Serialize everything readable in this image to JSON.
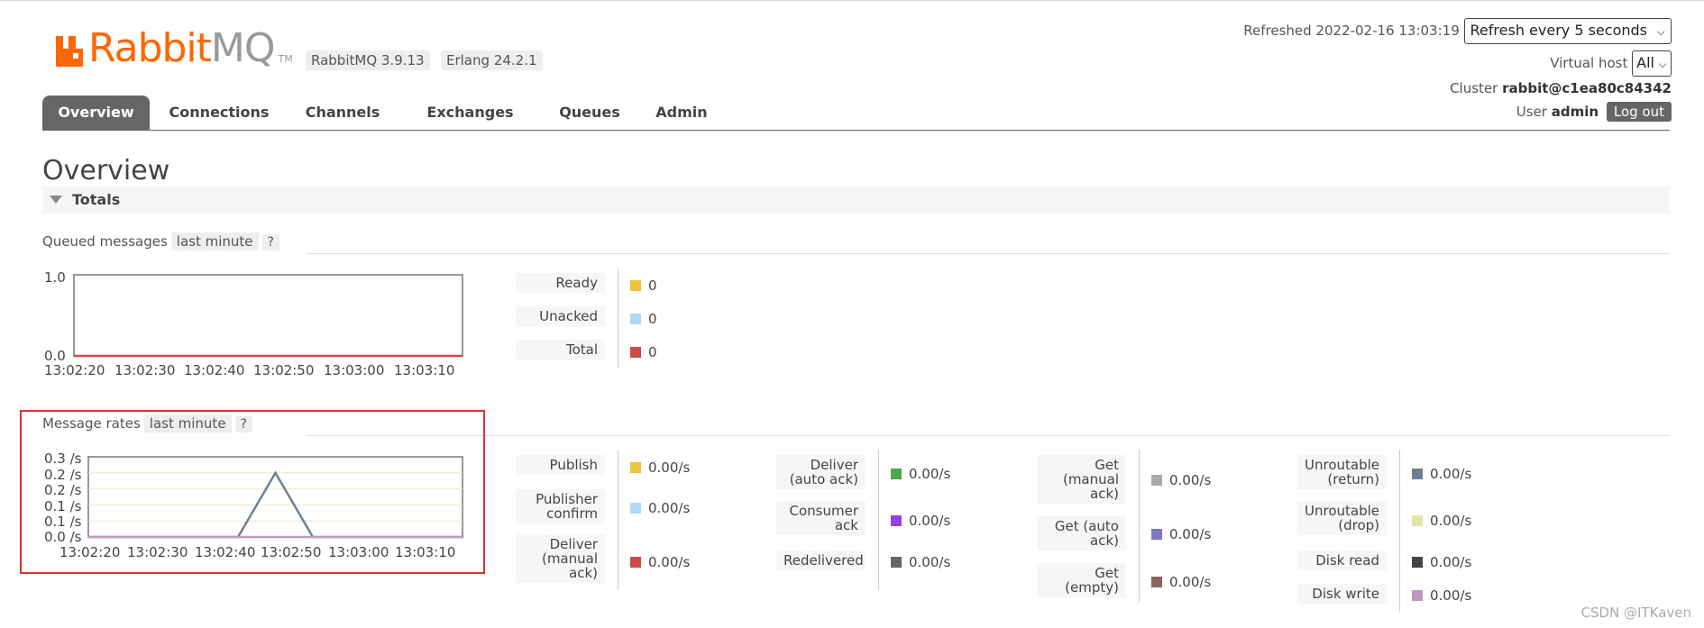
{
  "brand": {
    "rabbit": "Rabbit",
    "mq": "MQ",
    "tm": "TM",
    "color": "#ff6600"
  },
  "versions": {
    "rabbitmq": "RabbitMQ 3.9.13",
    "erlang": "Erlang 24.2.1"
  },
  "header": {
    "refreshed": "Refreshed 2022-02-16 13:03:19",
    "refresh_select": "Refresh every 5 seconds",
    "vhost_label": "Virtual host",
    "vhost_value": "All",
    "cluster_label": "Cluster",
    "cluster_value": "rabbit@c1ea80c84342",
    "user_label": "User",
    "user_value": "admin",
    "logout": "Log out"
  },
  "nav": {
    "tabs": [
      {
        "label": "Overview",
        "active": true
      },
      {
        "label": "Connections"
      },
      {
        "label": "Channels"
      },
      {
        "label": "Exchanges"
      },
      {
        "label": "Queues"
      },
      {
        "label": "Admin"
      }
    ]
  },
  "page": {
    "title": "Overview",
    "section": "Totals"
  },
  "queued": {
    "title": "Queued messages",
    "range": "last minute",
    "help": "?",
    "stats": [
      {
        "label": "Ready",
        "value": "0",
        "color": "#edc240"
      },
      {
        "label": "Unacked",
        "value": "0",
        "color": "#afd8f8"
      },
      {
        "label": "Total",
        "value": "0",
        "color": "#cb4b4b"
      }
    ]
  },
  "rates": {
    "title": "Message rates",
    "range": "last minute",
    "help": "?",
    "col1": [
      {
        "label": "Publish",
        "value": "0.00/s",
        "color": "#edc240"
      },
      {
        "label": "Publisher confirm",
        "value": "0.00/s",
        "color": "#afd8f8"
      },
      {
        "label": "Deliver (manual ack)",
        "value": "0.00/s",
        "color": "#cb4b4b"
      }
    ],
    "col2": [
      {
        "label": "Deliver (auto ack)",
        "value": "0.00/s",
        "color": "#4da74d"
      },
      {
        "label": "Consumer ack",
        "value": "0.00/s",
        "color": "#9440ed"
      },
      {
        "label": "Redelivered",
        "value": "0.00/s",
        "color": "#666666"
      }
    ],
    "col3": [
      {
        "label": "Get (manual ack)",
        "value": "0.00/s",
        "color": "#aaaaaa"
      },
      {
        "label": "Get (auto ack)",
        "value": "0.00/s",
        "color": "#7c79c3"
      },
      {
        "label": "Get (empty)",
        "value": "0.00/s",
        "color": "#8d6262"
      }
    ],
    "col4": [
      {
        "label": "Unroutable (return)",
        "value": "0.00/s",
        "color": "#6d8092"
      },
      {
        "label": "Unroutable (drop)",
        "value": "0.00/s",
        "color": "#e4e4a4"
      },
      {
        "label": "Disk read",
        "value": "0.00/s",
        "color": "#444444"
      },
      {
        "label": "Disk write",
        "value": "0.00/s",
        "color": "#bb99bb"
      }
    ]
  },
  "chart_data": [
    {
      "type": "line",
      "x": [
        "13:02:20",
        "13:02:30",
        "13:02:40",
        "13:02:50",
        "13:03:00",
        "13:03:10"
      ],
      "yticks": [
        "1.0",
        "0.0"
      ],
      "ylim": [
        0,
        1.0
      ],
      "series": [
        {
          "name": "Total",
          "color": "#cb4b4b",
          "values": [
            0,
            0,
            0,
            0,
            0,
            0
          ]
        }
      ]
    },
    {
      "type": "line",
      "x": [
        "13:02:20",
        "13:02:30",
        "13:02:40",
        "13:02:50",
        "13:03:00",
        "13:03:10"
      ],
      "yticks": [
        "0.3 /s",
        "0.2 /s",
        "0.2 /s",
        "0.1 /s",
        "0.1 /s",
        "0.0 /s"
      ],
      "ylim": [
        0,
        0.25
      ],
      "series": [
        {
          "color": "#6d8092",
          "points": [
            [
              0,
              0
            ],
            [
              0.4,
              0
            ],
            [
              0.5,
              0.2
            ],
            [
              0.6,
              0
            ],
            [
              1,
              0
            ]
          ]
        },
        {
          "color": "#bb99bb",
          "points": [
            [
              0,
              0
            ],
            [
              1,
              0
            ]
          ]
        }
      ]
    }
  ],
  "watermark": "CSDN @ITKaven"
}
